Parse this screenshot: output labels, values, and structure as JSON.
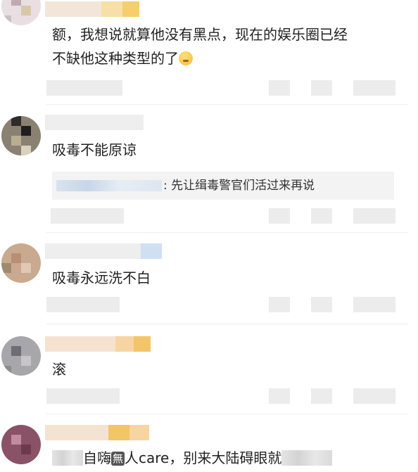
{
  "comments": [
    {
      "text_line1": "额，我想说就算他没有黑点，现在的娱乐圈已经",
      "text_line2": "不缺他这种类型的了",
      "emoji_icon": "thinking-face-emoji"
    },
    {
      "text": "吸毒不能原谅",
      "reply_text": ": 先让缉毒警官们活过来再说"
    },
    {
      "text": "吸毒永远洗不白"
    },
    {
      "text": "滚"
    },
    {
      "text_part1": "自嗨",
      "badge": "無",
      "text_part2": "人care，别来大陆碍眼就"
    }
  ]
}
